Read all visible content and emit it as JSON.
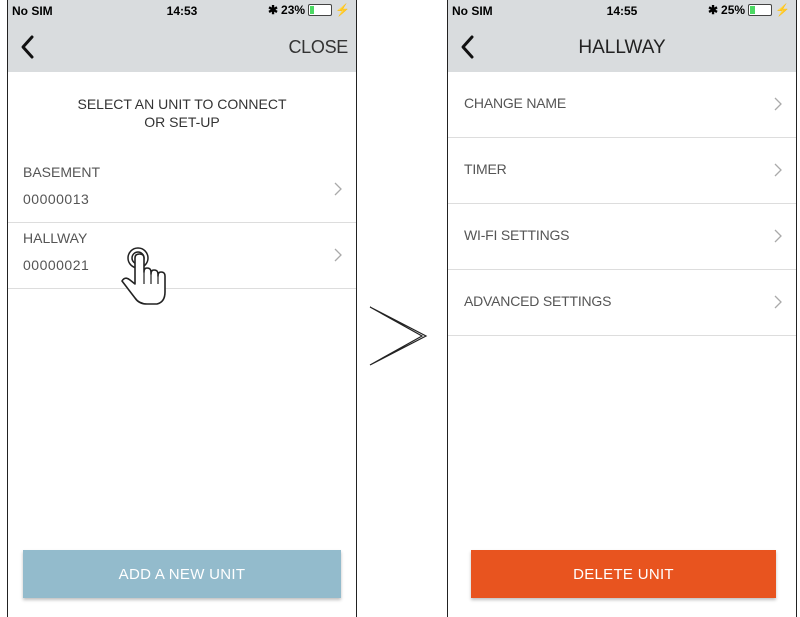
{
  "colors": {
    "navbar": "#d9dcde",
    "add_button": "#93bbcc",
    "delete_button": "#e8541f",
    "battery_fill": "#4cd964"
  },
  "left_screen": {
    "status": {
      "carrier": "No SIM",
      "time": "14:53",
      "battery": "23%",
      "battery_level": 23
    },
    "nav": {
      "back_icon": "chevron-left-icon",
      "close_label": "CLOSE"
    },
    "headline_line1": "SELECT AN UNIT TO CONNECT",
    "headline_line2": "OR SET-UP",
    "units": [
      {
        "name": "BASEMENT",
        "id": "00000013"
      },
      {
        "name": "HALLWAY",
        "id": "00000021"
      }
    ],
    "add_button": "ADD A NEW UNIT"
  },
  "transition_icon": "arrow-right-icon",
  "right_screen": {
    "status": {
      "carrier": "No SIM",
      "time": "14:55",
      "battery": "25%",
      "battery_level": 25
    },
    "nav": {
      "back_icon": "chevron-left-icon",
      "title": "HALLWAY"
    },
    "menu": [
      {
        "label": "CHANGE NAME"
      },
      {
        "label": "TIMER"
      },
      {
        "label": "WI-FI SETTINGS"
      },
      {
        "label": "ADVANCED SETTINGS"
      }
    ],
    "delete_button": "DELETE UNIT"
  }
}
